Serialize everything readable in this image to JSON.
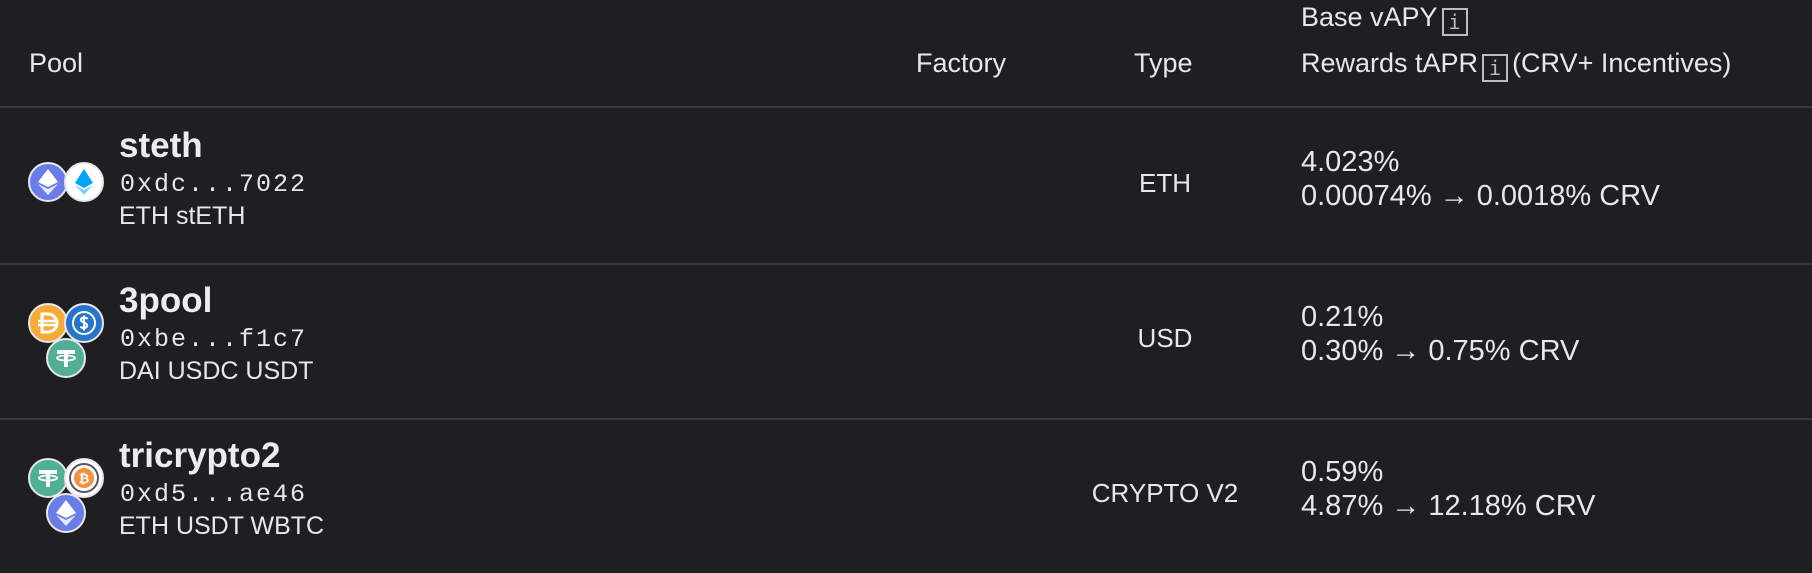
{
  "header": {
    "pool": "Pool",
    "factory": "Factory",
    "type": "Type",
    "base_vapy": "Base vAPY",
    "rewards_tapr": "Rewards tAPR",
    "rewards_suffix": "(CRV+ Incentives)",
    "info_glyph": "i"
  },
  "rows": [
    {
      "name": "steth",
      "address": "0xdc...7022",
      "coins": "ETH stETH",
      "type": "ETH",
      "base_vapy": "4.023%",
      "rewards": "0.00074% → 0.0018% CRV",
      "icons": [
        "eth-icon",
        "steth-icon"
      ]
    },
    {
      "name": "3pool",
      "address": "0xbe...f1c7",
      "coins": "DAI USDC USDT",
      "type": "USD",
      "base_vapy": "0.21%",
      "rewards": "0.30% → 0.75% CRV",
      "icons": [
        "dai-icon",
        "usdc-icon",
        "usdt-icon"
      ]
    },
    {
      "name": "tricrypto2",
      "address": "0xd5...ae46",
      "coins": "ETH USDT WBTC",
      "type": "CRYPTO V2",
      "base_vapy": "0.59%",
      "rewards": "4.87% → 12.18% CRV",
      "icons": [
        "usdt-icon",
        "wbtc-icon",
        "eth-icon"
      ]
    }
  ],
  "colors": {
    "background": "#1f1f22",
    "divider": "#3a3a3e",
    "text": "#e8e8ea",
    "eth": "#6a7ce8",
    "steth": "#ffffff",
    "dai": "#f5ac37",
    "usdc": "#2775ca",
    "usdt": "#50af95",
    "wbtc": "#f09242"
  }
}
